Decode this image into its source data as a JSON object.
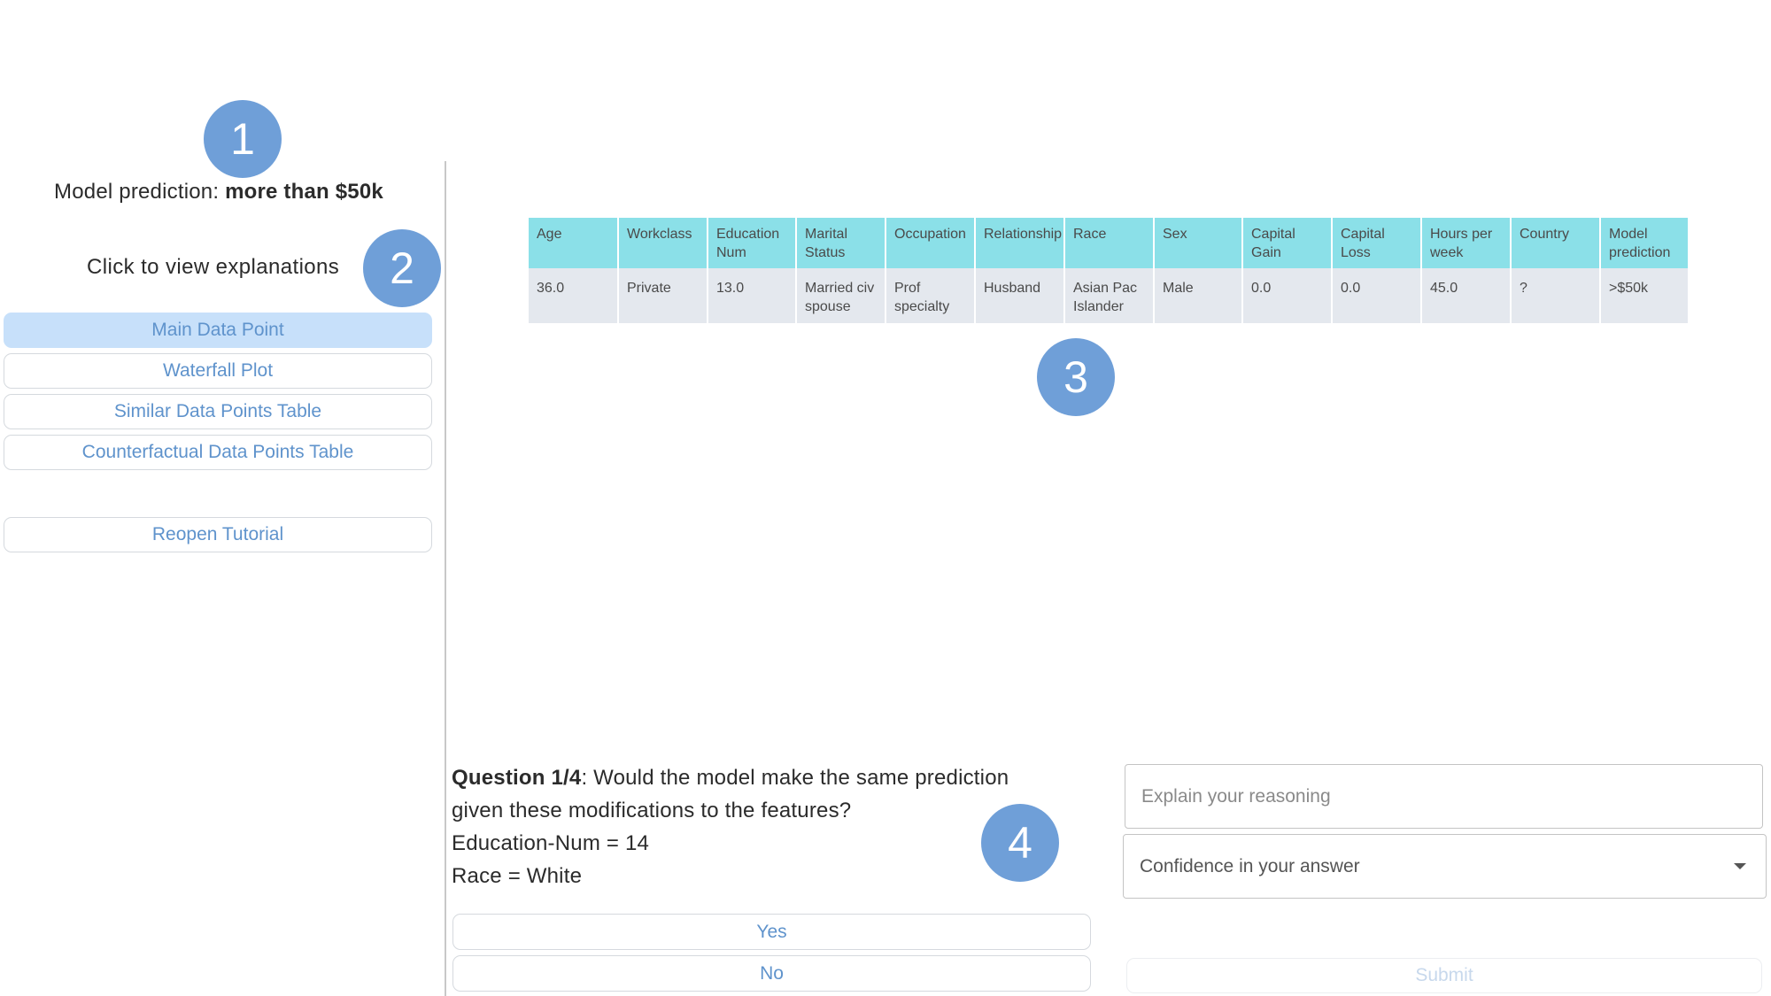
{
  "badges": [
    "1",
    "2",
    "3",
    "4"
  ],
  "sidebar": {
    "prediction_label": "Model prediction: ",
    "prediction_value": "more than $50k",
    "click_label": "Click to view explanations",
    "buttons": [
      {
        "label": "Main Data Point",
        "active": true
      },
      {
        "label": "Waterfall Plot",
        "active": false
      },
      {
        "label": "Similar Data Points Table",
        "active": false
      },
      {
        "label": "Counterfactual Data Points Table",
        "active": false
      }
    ],
    "tutorial_label": "Reopen Tutorial"
  },
  "table": {
    "headers": [
      "Age",
      "Workclass",
      "Education Num",
      "Marital Status",
      "Occupation",
      "Relationship",
      "Race",
      "Sex",
      "Capital Gain",
      "Capital Loss",
      "Hours per week",
      "Country",
      "Model prediction"
    ],
    "row": [
      "36.0",
      "Private",
      "13.0",
      "Married civ spouse",
      "Prof specialty",
      "Husband",
      "Asian Pac Islander",
      "Male",
      "0.0",
      "0.0",
      "45.0",
      "?",
      ">$50k"
    ]
  },
  "question": {
    "number": "Question 1/4",
    "text": ": Would the model make the same prediction given these modifications to the features?",
    "modifications": [
      "Education-Num = 14",
      "Race = White"
    ],
    "yes_label": "Yes",
    "no_label": "No"
  },
  "answer_form": {
    "reasoning_placeholder": "Explain your reasoning",
    "confidence_label": "Confidence in your answer",
    "submit_label": "Submit"
  },
  "colors": {
    "badge": "#6f9fd8",
    "accent_text": "#5f93cc",
    "active_button": "#c7e0fa",
    "table_header": "#8be0e8",
    "table_row": "#e4e8ee"
  }
}
